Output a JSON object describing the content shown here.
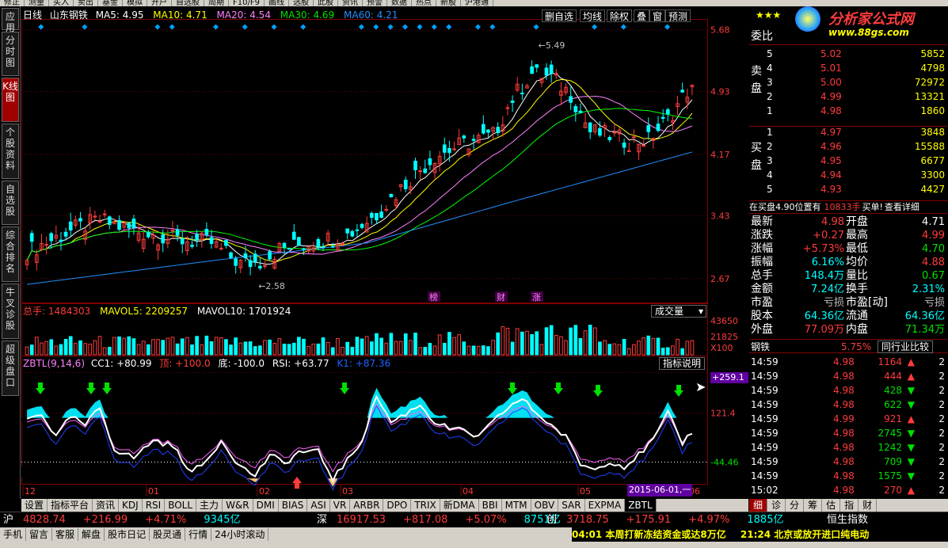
{
  "toolbar": {
    "items": [
      "修正",
      "测量",
      "买入",
      "卖出",
      "基金",
      "模拟",
      "开户",
      "自选股",
      "周期",
      "F10/F9",
      "画线",
      "选股",
      "此股",
      "资讯",
      "预警",
      "数据",
      "热点",
      "新股",
      "沪港通"
    ]
  },
  "logo": {
    "text": "分析家公式网",
    "url": "www.88gs.com"
  },
  "left_tabs": [
    "应用",
    "分时图",
    "K线图",
    "个股资料",
    "自选股",
    "综合排名",
    "牛叉诊股",
    "超级盘口"
  ],
  "legend": {
    "period": "日线",
    "name": "山东钢铁",
    "ma5": "MA5: 4.95",
    "ma10": "MA10: 4.71",
    "ma20": "MA20: 4.54",
    "ma30": "MA30: 4.69",
    "ma60": "MA60: 4.21"
  },
  "chart_buttons": [
    "删自选",
    "均线",
    "除权",
    "叠",
    "窗",
    "预测"
  ],
  "price_axis": [
    "5.68",
    "4.93",
    "4.17",
    "3.43",
    "2.67"
  ],
  "annotations": {
    "high": "5.49",
    "low": "2.58",
    "events": [
      "榜",
      "财",
      "涨"
    ]
  },
  "vol": {
    "legend_total": "总手: 1484303",
    "legend_mavol5": "MAVOL5: 2209257",
    "legend_mavol10": "MAVOL10: 1701924",
    "select": "成交量",
    "axis": [
      "43650",
      "21825",
      "X100"
    ]
  },
  "ind": {
    "legend_name": "ZBTL(9,14,6)",
    "cc1": "CC1: +80.99",
    "top": "顶: +100.0",
    "bottom": "底: -100.0",
    "rsi": "RSI: +63.77",
    "k1": "K1: +87.36",
    "button": "指标说明",
    "axis": [
      "259.1",
      "121.4",
      "-44.46"
    ],
    "axis_top": "+259.1"
  },
  "date_axis": [
    "12",
    "01",
    "02",
    "03",
    "04",
    "05",
    "06"
  ],
  "date_label": "2015-06-01,一",
  "bottom_tabs": [
    "设置",
    "指标平台",
    "资讯",
    "KDJ",
    "RSI",
    "BOLL",
    "主力",
    "W&R",
    "DMI",
    "BIAS",
    "ASI",
    "VR",
    "ARBR",
    "DPO",
    "TRIX",
    "新DMA",
    "BBI",
    "MTM",
    "OBV",
    "SAR",
    "EXPMA",
    "ZBTL"
  ],
  "right_tabs": [
    "细",
    "诊",
    "分",
    "筹",
    "估",
    "指",
    "财"
  ],
  "quote": {
    "weibi_label": "委比",
    "sell_label": "卖盘",
    "buy_label": "买盘",
    "sells": [
      {
        "n": "5",
        "p": "5.02",
        "v": "5852"
      },
      {
        "n": "4",
        "p": "5.01",
        "v": "4798"
      },
      {
        "n": "3",
        "p": "5.00",
        "v": "72972"
      },
      {
        "n": "2",
        "p": "4.99",
        "v": "13321"
      },
      {
        "n": "1",
        "p": "4.98",
        "v": "1860"
      }
    ],
    "buys": [
      {
        "n": "1",
        "p": "4.97",
        "v": "3848"
      },
      {
        "n": "2",
        "p": "4.96",
        "v": "15588"
      },
      {
        "n": "3",
        "p": "4.95",
        "v": "6677"
      },
      {
        "n": "4",
        "p": "4.94",
        "v": "3300"
      },
      {
        "n": "5",
        "p": "4.93",
        "v": "4427"
      }
    ],
    "note_left": "在买盘4.90位置有",
    "note_mid": "10833手",
    "note_right": "买单!",
    "note_link": "查看详细",
    "stats": [
      {
        "l1": "最新",
        "v1": "4.98",
        "c1": "red",
        "l2": "开盘",
        "v2": "4.71",
        "c2": "wht"
      },
      {
        "l1": "涨跌",
        "v1": "+0.27",
        "c1": "red",
        "l2": "最高",
        "v2": "4.99",
        "c2": "red"
      },
      {
        "l1": "涨幅",
        "v1": "+5.73%",
        "c1": "red",
        "l2": "最低",
        "v2": "4.70",
        "c2": "grn"
      },
      {
        "l1": "振幅",
        "v1": "6.16%",
        "c1": "cy",
        "l2": "均价",
        "v2": "4.88",
        "c2": "red"
      },
      {
        "l1": "总手",
        "v1": "148.4万",
        "c1": "cy",
        "l2": "量比",
        "v2": "0.67",
        "c2": "grn"
      },
      {
        "l1": "金额",
        "v1": "7.24亿",
        "c1": "cy",
        "l2": "换手",
        "v2": "2.31%",
        "c2": "cy"
      },
      {
        "l1": "市盈",
        "v1": "亏损",
        "c1": "gry",
        "l2": "市盈[动]",
        "v2": "亏损",
        "c2": "gry"
      },
      {
        "l1": "股本",
        "v1": "64.36亿",
        "c1": "cy",
        "l2": "流通",
        "v2": "64.36亿",
        "c2": "cy"
      },
      {
        "l1": "外盘",
        "v1": "77.09万",
        "c1": "red",
        "l2": "内盘",
        "v2": "71.34万",
        "c2": "grn"
      }
    ],
    "industry": {
      "name": "钢铁",
      "pct": "5.75%",
      "button": "同行业比较"
    },
    "ticks": [
      {
        "t": "14:59",
        "p": "4.98",
        "v": "1164",
        "d": "up",
        "n": "2"
      },
      {
        "t": "14:59",
        "p": "4.98",
        "v": "444",
        "d": "up",
        "n": "2"
      },
      {
        "t": "14:59",
        "p": "4.98",
        "v": "428",
        "d": "dn",
        "n": "2"
      },
      {
        "t": "14:59",
        "p": "4.98",
        "v": "622",
        "d": "dn",
        "n": "2"
      },
      {
        "t": "14:59",
        "p": "4.99",
        "v": "921",
        "d": "up",
        "n": "2"
      },
      {
        "t": "14:59",
        "p": "4.98",
        "v": "2745",
        "d": "dn",
        "n": "2"
      },
      {
        "t": "14:59",
        "p": "4.98",
        "v": "1242",
        "d": "dn",
        "n": "2"
      },
      {
        "t": "14:59",
        "p": "4.98",
        "v": "709",
        "d": "dn",
        "n": "2"
      },
      {
        "t": "14:59",
        "p": "4.98",
        "v": "1575",
        "d": "dn",
        "n": "2"
      },
      {
        "t": "15:02",
        "p": "4.98",
        "v": "270",
        "d": "up",
        "n": "2"
      }
    ]
  },
  "index_bar": [
    {
      "name": "沪",
      "val": "4828.74",
      "chg": "+216.99",
      "pct": "+4.71%",
      "amt": "9345亿"
    },
    {
      "name": "深",
      "val": "16917.53",
      "chg": "+817.08",
      "pct": "+5.07%",
      "amt": "8751亿"
    },
    {
      "name": "创",
      "val": "3718.75",
      "chg": "+175.91",
      "pct": "+4.97%",
      "amt": "1885亿"
    }
  ],
  "index_tail": "恒生指数",
  "status": {
    "items": [
      "手机",
      "留言",
      "客服",
      "解盘",
      "股市日记",
      "股灵通",
      "行情",
      "24小时滚动"
    ],
    "news1": "04:01 本周打新冻结资金或达8万亿",
    "news2": "21:24 北京或放开进口纯电动"
  },
  "colors": {
    "up": "#ff3c3c",
    "down": "#00ffff",
    "ma5": "#ffffff",
    "ma10": "#ffff00",
    "ma20": "#ff80ff",
    "ma30": "#00ff00",
    "ma60": "#2090ff",
    "grid": "#800000"
  },
  "chart_data": {
    "type": "candlestick",
    "price_range": [
      2.4,
      5.75
    ],
    "vol_range": [
      0,
      43650
    ],
    "ind_range": [
      -110,
      260
    ],
    "segments": [
      [
        0,
        2.95,
        3.05
      ],
      [
        10,
        3.05,
        3.5
      ],
      [
        15,
        3.4,
        3.35
      ],
      [
        22,
        3.3,
        3.2
      ],
      [
        30,
        3.2,
        3.1
      ],
      [
        38,
        3.15,
        3.05
      ],
      [
        44,
        2.98,
        2.72
      ],
      [
        48,
        2.8,
        2.95
      ],
      [
        52,
        2.95,
        3.1
      ],
      [
        60,
        3.1,
        3.15
      ],
      [
        66,
        3.15,
        3.25
      ],
      [
        72,
        3.3,
        3.6
      ],
      [
        78,
        3.6,
        4.05
      ],
      [
        84,
        4.05,
        4.25
      ],
      [
        90,
        4.3,
        4.3
      ],
      [
        96,
        4.3,
        4.5
      ],
      [
        100,
        4.5,
        5.2
      ],
      [
        104,
        5.3,
        5.0
      ],
      [
        108,
        5.0,
        5.2
      ],
      [
        112,
        5.2,
        4.6
      ],
      [
        116,
        4.6,
        4.3
      ],
      [
        120,
        4.35,
        4.45
      ],
      [
        124,
        4.4,
        4.25
      ],
      [
        128,
        4.3,
        4.4
      ],
      [
        132,
        4.4,
        4.8
      ],
      [
        136,
        4.9,
        4.98
      ]
    ],
    "ma60": [
      [
        0,
        2.6
      ],
      [
        40,
        2.9
      ],
      [
        70,
        3.1
      ],
      [
        100,
        3.6
      ],
      [
        137,
        4.2
      ]
    ],
    "ind_segments": [
      [
        0,
        100
      ],
      [
        3,
        120
      ],
      [
        6,
        40
      ],
      [
        9,
        110
      ],
      [
        12,
        80
      ],
      [
        15,
        140
      ],
      [
        18,
        0
      ],
      [
        22,
        -30
      ],
      [
        26,
        30
      ],
      [
        30,
        10
      ],
      [
        34,
        -80
      ],
      [
        37,
        -40
      ],
      [
        40,
        30
      ],
      [
        44,
        -60
      ],
      [
        47,
        -90
      ],
      [
        50,
        -20
      ],
      [
        53,
        -50
      ],
      [
        56,
        -10
      ],
      [
        60,
        -10
      ],
      [
        63,
        -100
      ],
      [
        66,
        -40
      ],
      [
        69,
        30
      ],
      [
        72,
        180
      ],
      [
        75,
        90
      ],
      [
        78,
        120
      ],
      [
        81,
        150
      ],
      [
        84,
        90
      ],
      [
        87,
        70
      ],
      [
        90,
        60
      ],
      [
        93,
        40
      ],
      [
        96,
        90
      ],
      [
        99,
        140
      ],
      [
        102,
        170
      ],
      [
        105,
        120
      ],
      [
        108,
        80
      ],
      [
        111,
        40
      ],
      [
        114,
        -50
      ],
      [
        117,
        -70
      ],
      [
        120,
        -40
      ],
      [
        123,
        -60
      ],
      [
        126,
        -20
      ],
      [
        129,
        30
      ],
      [
        132,
        120
      ],
      [
        135,
        20
      ],
      [
        137,
        60
      ]
    ]
  }
}
